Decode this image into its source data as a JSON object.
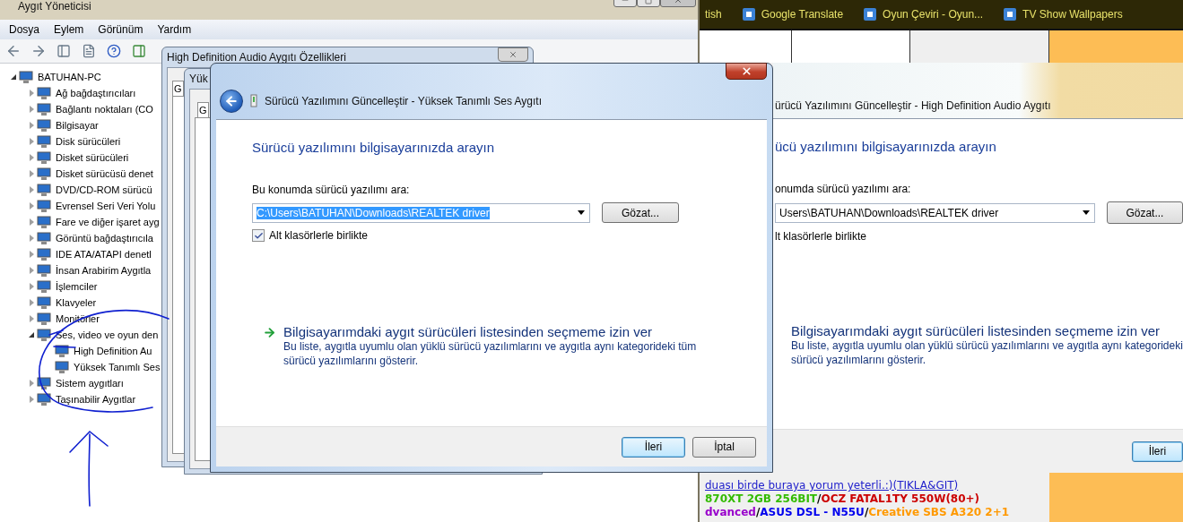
{
  "device_manager": {
    "title": "Aygıt Yöneticisi",
    "menu": [
      "Dosya",
      "Eylem",
      "Görünüm",
      "Yardım"
    ],
    "tree": {
      "label": "BATUHAN-PC",
      "expanded": true,
      "children": [
        {
          "label": "Ağ bağdaştırıcıları",
          "expanded": false
        },
        {
          "label": "Bağlantı noktaları (CO",
          "expanded": false
        },
        {
          "label": "Bilgisayar",
          "expanded": false
        },
        {
          "label": "Disk sürücüleri",
          "expanded": false
        },
        {
          "label": "Disket sürücüleri",
          "expanded": false
        },
        {
          "label": "Disket sürücüsü denet",
          "expanded": false
        },
        {
          "label": "DVD/CD-ROM sürücü",
          "expanded": false
        },
        {
          "label": "Evrensel Seri Veri Yolu",
          "expanded": false
        },
        {
          "label": "Fare ve diğer işaret ayg",
          "expanded": false
        },
        {
          "label": "Görüntü bağdaştırıcıla",
          "expanded": false
        },
        {
          "label": "IDE ATA/ATAPI denetl",
          "expanded": false
        },
        {
          "label": "İnsan Arabirim Aygıtla",
          "expanded": false
        },
        {
          "label": "İşlemciler",
          "expanded": false
        },
        {
          "label": "Klavyeler",
          "expanded": false
        },
        {
          "label": "Monitörler",
          "expanded": false
        },
        {
          "label": "Ses, video ve oyun den",
          "expanded": true,
          "children": [
            {
              "label": "High Definition Au"
            },
            {
              "label": "Yüksek Tanımlı Ses"
            }
          ]
        },
        {
          "label": "Sistem aygıtları",
          "expanded": false
        },
        {
          "label": "Taşınabilir Aygıtlar",
          "expanded": false
        }
      ]
    }
  },
  "properties_window": {
    "title": "High Definition Audio Aygıtı Özellikleri",
    "tab": "G"
  },
  "inner_properties_window": {
    "title": "Yük",
    "tab": "G"
  },
  "browser": {
    "bookmarks": [
      {
        "label": "tish",
        "icon": false
      },
      {
        "label": "Google Translate",
        "icon": true
      },
      {
        "label": "Oyun Çeviri - Oyun...",
        "icon": true
      },
      {
        "label": "TV Show Wallpapers",
        "icon": true
      }
    ],
    "signature_link": "duası birde buraya yorum yeterli.:)(TIKLA&GIT)",
    "signature": [
      [
        {
          "text": "870XT 2GB 256BIT",
          "color": "#33bb00"
        },
        {
          "text": "/",
          "color": "#000000"
        },
        {
          "text": "OCZ FATAL1TY 550W(80+)",
          "color": "#cc0000"
        }
      ],
      [
        {
          "text": "dvanced",
          "color": "#9900cc"
        },
        {
          "text": "/",
          "color": "#000000"
        },
        {
          "text": "ASUS DSL - N55U",
          "color": "#0000ee"
        },
        {
          "text": "/",
          "color": "#000000"
        },
        {
          "text": "Creative SBS A320 2+1",
          "color": "#ff9900"
        }
      ]
    ]
  },
  "driver_dialog_back": {
    "title": "ürücü Yazılımını Güncelleştir - High Definition Audio Aygıtı",
    "heading": "ücü yazılımını bilgisayarınızda arayın",
    "location_label": "onumda sürücü yazılımı ara:",
    "path": {
      "value": "Users\\BATUHAN\\Downloads\\REALTEK driver",
      "selected": false
    },
    "browse_button": "Gözat...",
    "subfolders_label": "lt klasörlerle birlikte",
    "option": {
      "title": "Bilgisayarımdaki aygıt sürücüleri listesinden seçmeme izin ver",
      "lines": [
        "Bu liste, aygıtla uyumlu olan yüklü sürücü yazılımlarını ve aygıtla aynı kategorideki",
        "sürücü yazılımlarını gösterir."
      ]
    },
    "buttons": [
      {
        "label": "İleri",
        "default": true
      }
    ]
  },
  "driver_dialog": {
    "title": "Sürücü Yazılımını Güncelleştir - Yüksek Tanımlı Ses Aygıtı",
    "heading": "Sürücü yazılımını bilgisayarınızda arayın",
    "location_label": "Bu konumda sürücü yazılımı ara:",
    "path": {
      "value": "C:\\Users\\BATUHAN\\Downloads\\REALTEK driver",
      "selected": true
    },
    "browse_button": "Gözat...",
    "subfolders": {
      "label": "Alt klasörlerle birlikte",
      "checked": true
    },
    "option": {
      "title": "Bilgisayarımdaki aygıt sürücüleri listesinden seçmeme izin ver",
      "lines": [
        "Bu liste, aygıtla uyumlu olan yüklü sürücü yazılımlarını ve aygıtla aynı kategorideki tüm",
        "sürücü yazılımlarını gösterir."
      ]
    },
    "buttons": [
      {
        "label": "İleri",
        "default": true
      },
      {
        "label": "İptal",
        "default": false
      }
    ]
  }
}
